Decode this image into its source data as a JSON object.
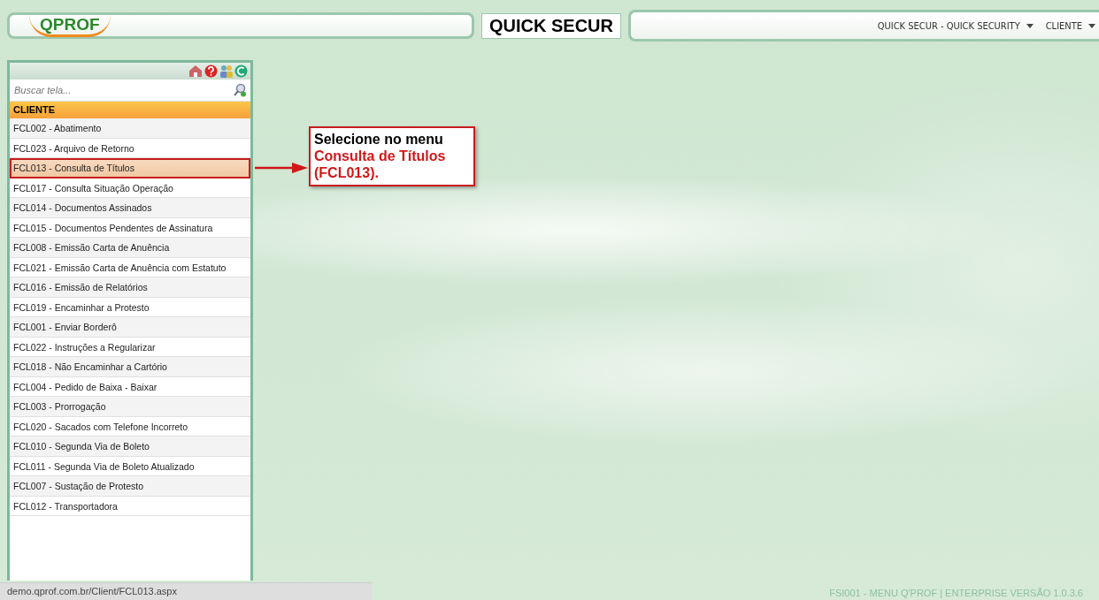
{
  "header": {
    "logo": "QPROF",
    "title": "QUICK SECUR",
    "menus": [
      {
        "label": "QUICK SECUR - QUICK SECURITY"
      },
      {
        "label": "CLIENTE"
      }
    ]
  },
  "sidebar": {
    "search": {
      "placeholder": "Buscar tela..."
    },
    "group": "CLIENTE",
    "items": [
      {
        "label": "FCL002 - Abatimento",
        "selected": false
      },
      {
        "label": "FCL023 - Arquivo de Retorno",
        "selected": false
      },
      {
        "label": "FCL013 - Consulta de Títulos",
        "selected": true
      },
      {
        "label": "FCL017 - Consulta Situação Operação",
        "selected": false
      },
      {
        "label": "FCL014 - Documentos Assinados",
        "selected": false
      },
      {
        "label": "FCL015 - Documentos Pendentes de Assinatura",
        "selected": false
      },
      {
        "label": "FCL008 - Emissão Carta de Anuência",
        "selected": false
      },
      {
        "label": "FCL021 - Emissão Carta de Anuência com Estatuto",
        "selected": false
      },
      {
        "label": "FCL016 - Emissão de Relatórios",
        "selected": false
      },
      {
        "label": "FCL019 - Encaminhar a Protesto",
        "selected": false
      },
      {
        "label": "FCL001 - Enviar Borderô",
        "selected": false
      },
      {
        "label": "FCL022 - Instruções a Regularizar",
        "selected": false
      },
      {
        "label": "FCL018 - Não Encaminhar a Cartório",
        "selected": false
      },
      {
        "label": "FCL004 - Pedido de Baixa - Baixar",
        "selected": false
      },
      {
        "label": "FCL003 - Prorrogação",
        "selected": false
      },
      {
        "label": "FCL020 - Sacados com Telefone Incorreto",
        "selected": false
      },
      {
        "label": "FCL010 - Segunda Via de Boleto",
        "selected": false
      },
      {
        "label": "FCL011 - Segunda Via de Boleto Atualizado",
        "selected": false
      },
      {
        "label": "FCL007 - Sustação de Protesto",
        "selected": false
      },
      {
        "label": "FCL012 - Transportadora",
        "selected": false
      }
    ]
  },
  "callout": {
    "intro": "Selecione no menu",
    "highlight": "Consulta de Títulos (FCL013)."
  },
  "status_bar": {
    "url": "demo.qprof.com.br/Client/FCL013.aspx"
  },
  "footer": "FSI001 - MENU Q'PROF | ENTERPRISE VERSÃO 1.0.3.6"
}
